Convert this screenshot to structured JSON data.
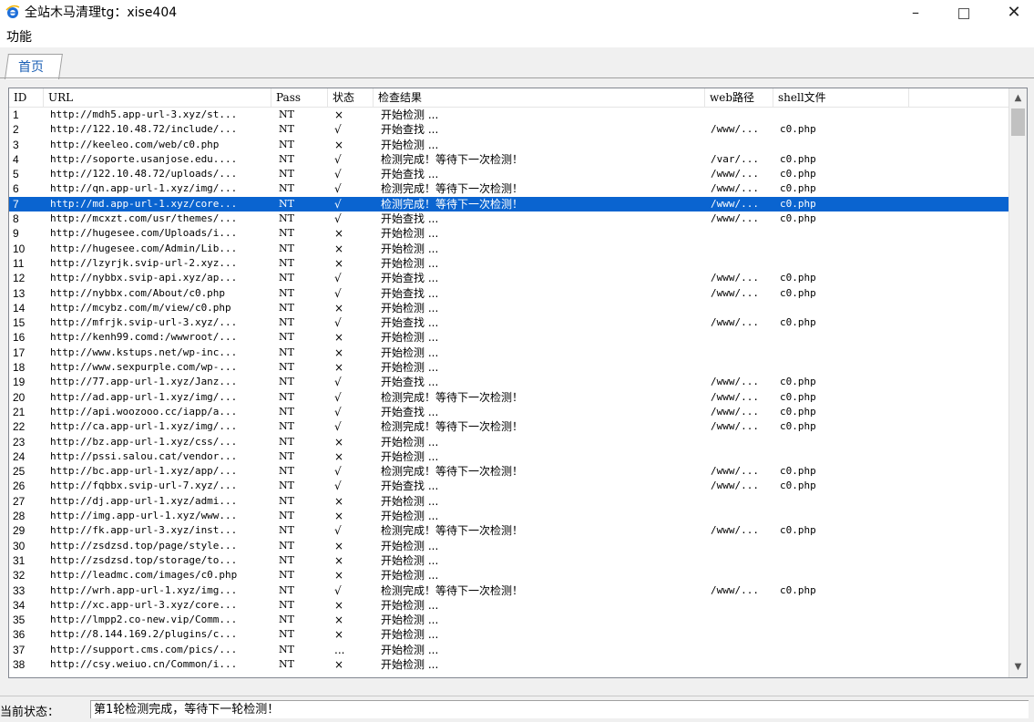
{
  "window": {
    "title": "全站木马清理tg：xise404",
    "icon": "ie-e-icon",
    "minimize": "–",
    "close": "✕"
  },
  "menu": {
    "items": [
      "功能"
    ]
  },
  "tabs": [
    {
      "label": "首页"
    }
  ],
  "table": {
    "columns": [
      "ID",
      "URL",
      "Pass",
      "状态",
      "检查结果",
      "web路径",
      "shell文件"
    ],
    "selected_id": "7",
    "rows": [
      {
        "id": "1",
        "url": "http://mdh5.app-url-3.xyz/st...",
        "pass": "NT",
        "status": "×",
        "result": "开始检测 ...",
        "web": "",
        "shell": ""
      },
      {
        "id": "2",
        "url": "http://122.10.48.72/include/...",
        "pass": "NT",
        "status": "√",
        "result": "开始查找 ...",
        "web": "/www/...",
        "shell": "c0.php"
      },
      {
        "id": "3",
        "url": "http://keeleo.com/web/c0.php",
        "pass": "NT",
        "status": "×",
        "result": "开始检测 ...",
        "web": "",
        "shell": ""
      },
      {
        "id": "4",
        "url": "http://soporte.usanjose.edu....",
        "pass": "NT",
        "status": "√",
        "result": "检测完成！等待下一次检测！",
        "web": "/var/...",
        "shell": "c0.php"
      },
      {
        "id": "5",
        "url": "http://122.10.48.72/uploads/...",
        "pass": "NT",
        "status": "√",
        "result": "开始查找 ...",
        "web": "/www/...",
        "shell": "c0.php"
      },
      {
        "id": "6",
        "url": "http://qn.app-url-1.xyz/img/...",
        "pass": "NT",
        "status": "√",
        "result": "检测完成！等待下一次检测！",
        "web": "/www/...",
        "shell": "c0.php"
      },
      {
        "id": "7",
        "url": "http://md.app-url-1.xyz/core...",
        "pass": "NT",
        "status": "√",
        "result": "检测完成！等待下一次检测！",
        "web": "/www/...",
        "shell": "c0.php"
      },
      {
        "id": "8",
        "url": "http://mcxzt.com/usr/themes/...",
        "pass": "NT",
        "status": "√",
        "result": "开始查找 ...",
        "web": "/www/...",
        "shell": "c0.php"
      },
      {
        "id": "9",
        "url": "http://hugesee.com/Uploads/i...",
        "pass": "NT",
        "status": "×",
        "result": "开始检测 ...",
        "web": "",
        "shell": ""
      },
      {
        "id": "10",
        "url": "http://hugesee.com/Admin/Lib...",
        "pass": "NT",
        "status": "×",
        "result": "开始检测 ...",
        "web": "",
        "shell": ""
      },
      {
        "id": "11",
        "url": "http://lzyrjk.svip-url-2.xyz...",
        "pass": "NT",
        "status": "×",
        "result": "开始检测 ...",
        "web": "",
        "shell": ""
      },
      {
        "id": "12",
        "url": "http://nybbx.svip-api.xyz/ap...",
        "pass": "NT",
        "status": "√",
        "result": "开始查找 ...",
        "web": "/www/...",
        "shell": "c0.php"
      },
      {
        "id": "13",
        "url": "http://nybbx.com/About/c0.php",
        "pass": "NT",
        "status": "√",
        "result": "开始查找 ...",
        "web": "/www/...",
        "shell": "c0.php"
      },
      {
        "id": "14",
        "url": "http://mcybz.com/m/view/c0.php",
        "pass": "NT",
        "status": "×",
        "result": "开始检测 ...",
        "web": "",
        "shell": ""
      },
      {
        "id": "15",
        "url": "http://mfrjk.svip-url-3.xyz/...",
        "pass": "NT",
        "status": "√",
        "result": "开始查找 ...",
        "web": "/www/...",
        "shell": "c0.php"
      },
      {
        "id": "16",
        "url": "http://kenh99.comd:/wwwroot/...",
        "pass": "NT",
        "status": "×",
        "result": "开始检测 ...",
        "web": "",
        "shell": ""
      },
      {
        "id": "17",
        "url": "http://www.kstups.net/wp-inc...",
        "pass": "NT",
        "status": "×",
        "result": "开始检测 ...",
        "web": "",
        "shell": ""
      },
      {
        "id": "18",
        "url": "http://www.sexpurple.com/wp-...",
        "pass": "NT",
        "status": "×",
        "result": "开始检测 ...",
        "web": "",
        "shell": ""
      },
      {
        "id": "19",
        "url": "http://77.app-url-1.xyz/Janz...",
        "pass": "NT",
        "status": "√",
        "result": "开始查找 ...",
        "web": "/www/...",
        "shell": "c0.php"
      },
      {
        "id": "20",
        "url": "http://ad.app-url-1.xyz/img/...",
        "pass": "NT",
        "status": "√",
        "result": "检测完成！等待下一次检测！",
        "web": "/www/...",
        "shell": "c0.php"
      },
      {
        "id": "21",
        "url": "http://api.woozooo.cc/iapp/a...",
        "pass": "NT",
        "status": "√",
        "result": "开始查找 ...",
        "web": "/www/...",
        "shell": "c0.php"
      },
      {
        "id": "22",
        "url": "http://ca.app-url-1.xyz/img/...",
        "pass": "NT",
        "status": "√",
        "result": "检测完成！等待下一次检测！",
        "web": "/www/...",
        "shell": "c0.php"
      },
      {
        "id": "23",
        "url": "http://bz.app-url-1.xyz/css/...",
        "pass": "NT",
        "status": "×",
        "result": "开始检测 ...",
        "web": "",
        "shell": ""
      },
      {
        "id": "24",
        "url": "http://pssi.salou.cat/vendor...",
        "pass": "NT",
        "status": "×",
        "result": "开始检测 ...",
        "web": "",
        "shell": ""
      },
      {
        "id": "25",
        "url": "http://bc.app-url-1.xyz/app/...",
        "pass": "NT",
        "status": "√",
        "result": "检测完成！等待下一次检测！",
        "web": "/www/...",
        "shell": "c0.php"
      },
      {
        "id": "26",
        "url": "http://fqbbx.svip-url-7.xyz/...",
        "pass": "NT",
        "status": "√",
        "result": "开始查找 ...",
        "web": "/www/...",
        "shell": "c0.php"
      },
      {
        "id": "27",
        "url": "http://dj.app-url-1.xyz/admi...",
        "pass": "NT",
        "status": "×",
        "result": "开始检测 ...",
        "web": "",
        "shell": ""
      },
      {
        "id": "28",
        "url": "http://img.app-url-1.xyz/www...",
        "pass": "NT",
        "status": "×",
        "result": "开始检测 ...",
        "web": "",
        "shell": ""
      },
      {
        "id": "29",
        "url": "http://fk.app-url-3.xyz/inst...",
        "pass": "NT",
        "status": "√",
        "result": "检测完成！等待下一次检测！",
        "web": "/www/...",
        "shell": "c0.php"
      },
      {
        "id": "30",
        "url": "http://zsdzsd.top/page/style...",
        "pass": "NT",
        "status": "×",
        "result": "开始检测 ...",
        "web": "",
        "shell": ""
      },
      {
        "id": "31",
        "url": "http://zsdzsd.top/storage/to...",
        "pass": "NT",
        "status": "×",
        "result": "开始检测 ...",
        "web": "",
        "shell": ""
      },
      {
        "id": "32",
        "url": "http://leadmc.com/images/c0.php",
        "pass": "NT",
        "status": "×",
        "result": "开始检测 ...",
        "web": "",
        "shell": ""
      },
      {
        "id": "33",
        "url": "http://wrh.app-url-1.xyz/img...",
        "pass": "NT",
        "status": "√",
        "result": "检测完成！等待下一次检测！",
        "web": "/www/...",
        "shell": "c0.php"
      },
      {
        "id": "34",
        "url": "http://xc.app-url-3.xyz/core...",
        "pass": "NT",
        "status": "×",
        "result": "开始检测 ...",
        "web": "",
        "shell": ""
      },
      {
        "id": "35",
        "url": "http://lmpp2.co-new.vip/Comm...",
        "pass": "NT",
        "status": "×",
        "result": "开始检测 ...",
        "web": "",
        "shell": ""
      },
      {
        "id": "36",
        "url": "http://8.144.169.2/plugins/c...",
        "pass": "NT",
        "status": "×",
        "result": "开始检测 ...",
        "web": "",
        "shell": ""
      },
      {
        "id": "37",
        "url": "http://support.cms.com/pics/...",
        "pass": "NT",
        "status": "...",
        "result": "开始检测 ...",
        "web": "",
        "shell": ""
      },
      {
        "id": "38",
        "url": "http://csy.weiuo.cn/Common/i...",
        "pass": "NT",
        "status": "×",
        "result": "开始检测 ...",
        "web": "",
        "shell": ""
      }
    ]
  },
  "statusbar": {
    "label": "当前状态：",
    "value": "第1轮检测完成，等待下一轮检测！"
  }
}
